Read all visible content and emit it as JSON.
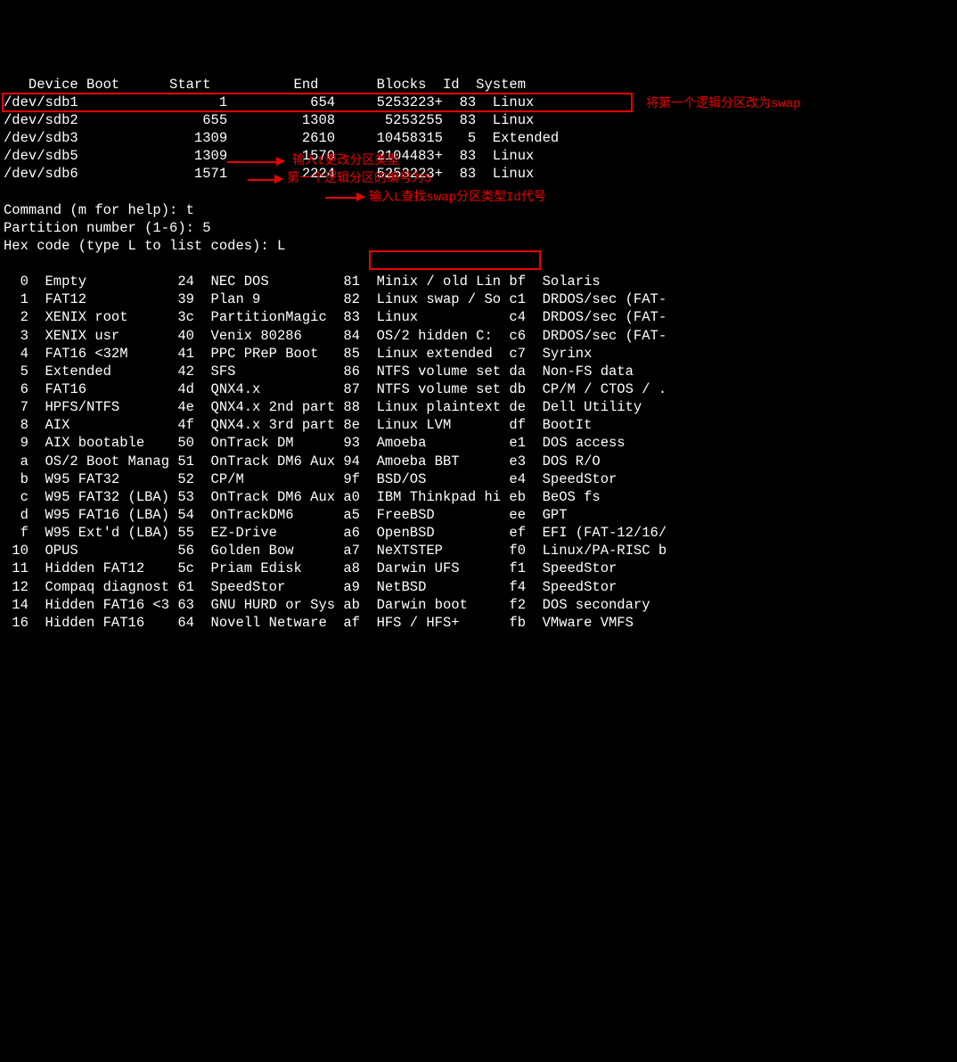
{
  "partition_table": {
    "header": {
      "device": "Device",
      "boot": "Boot",
      "start": "Start",
      "end": "End",
      "blocks": "Blocks",
      "id": "Id",
      "system": "System"
    },
    "rows": [
      {
        "device": "/dev/sdb1",
        "boot": "",
        "start": "1",
        "end": "654",
        "blocks": "5253223+",
        "id": "83",
        "system": "Linux"
      },
      {
        "device": "/dev/sdb2",
        "boot": "",
        "start": "655",
        "end": "1308",
        "blocks": "5253255",
        "id": "83",
        "system": "Linux"
      },
      {
        "device": "/dev/sdb3",
        "boot": "",
        "start": "1309",
        "end": "2610",
        "blocks": "10458315",
        "id": "5",
        "system": "Extended"
      },
      {
        "device": "/dev/sdb5",
        "boot": "",
        "start": "1309",
        "end": "1570",
        "blocks": "2104483+",
        "id": "83",
        "system": "Linux"
      },
      {
        "device": "/dev/sdb6",
        "boot": "",
        "start": "1571",
        "end": "2224",
        "blocks": "5253223+",
        "id": "83",
        "system": "Linux"
      }
    ]
  },
  "prompts": {
    "command": "Command (m for help): t",
    "partition_number": "Partition number (1-6): 5",
    "hex_code": "Hex code (type L to list codes): L"
  },
  "annotations": {
    "swap_change": "将第一个逻辑分区改为swap",
    "input_t": "输入t更改分区类型",
    "partition_5": "第一个逻辑分区的编号为5",
    "input_L": "输入L查找swap分区类型Id代号"
  },
  "type_list": {
    "col1": [
      {
        "code": "0",
        "name": "Empty"
      },
      {
        "code": "1",
        "name": "FAT12"
      },
      {
        "code": "2",
        "name": "XENIX root"
      },
      {
        "code": "3",
        "name": "XENIX usr"
      },
      {
        "code": "4",
        "name": "FAT16 <32M"
      },
      {
        "code": "5",
        "name": "Extended"
      },
      {
        "code": "6",
        "name": "FAT16"
      },
      {
        "code": "7",
        "name": "HPFS/NTFS"
      },
      {
        "code": "8",
        "name": "AIX"
      },
      {
        "code": "9",
        "name": "AIX bootable"
      },
      {
        "code": "a",
        "name": "OS/2 Boot Manag"
      },
      {
        "code": "b",
        "name": "W95 FAT32"
      },
      {
        "code": "c",
        "name": "W95 FAT32 (LBA)"
      },
      {
        "code": "d",
        "name": "W95 FAT16 (LBA)"
      },
      {
        "code": "f",
        "name": "W95 Ext'd (LBA)"
      },
      {
        "code": "10",
        "name": "OPUS"
      },
      {
        "code": "11",
        "name": "Hidden FAT12"
      },
      {
        "code": "12",
        "name": "Compaq diagnost"
      },
      {
        "code": "14",
        "name": "Hidden FAT16 <3"
      },
      {
        "code": "16",
        "name": "Hidden FAT16"
      }
    ],
    "col2": [
      {
        "code": "24",
        "name": "NEC DOS"
      },
      {
        "code": "39",
        "name": "Plan 9"
      },
      {
        "code": "3c",
        "name": "PartitionMagic"
      },
      {
        "code": "40",
        "name": "Venix 80286"
      },
      {
        "code": "41",
        "name": "PPC PReP Boot"
      },
      {
        "code": "42",
        "name": "SFS"
      },
      {
        "code": "4d",
        "name": "QNX4.x"
      },
      {
        "code": "4e",
        "name": "QNX4.x 2nd part"
      },
      {
        "code": "4f",
        "name": "QNX4.x 3rd part"
      },
      {
        "code": "50",
        "name": "OnTrack DM"
      },
      {
        "code": "51",
        "name": "OnTrack DM6 Aux"
      },
      {
        "code": "52",
        "name": "CP/M"
      },
      {
        "code": "53",
        "name": "OnTrack DM6 Aux"
      },
      {
        "code": "54",
        "name": "OnTrackDM6"
      },
      {
        "code": "55",
        "name": "EZ-Drive"
      },
      {
        "code": "56",
        "name": "Golden Bow"
      },
      {
        "code": "5c",
        "name": "Priam Edisk"
      },
      {
        "code": "61",
        "name": "SpeedStor"
      },
      {
        "code": "63",
        "name": "GNU HURD or Sys"
      },
      {
        "code": "64",
        "name": "Novell Netware"
      }
    ],
    "col3": [
      {
        "code": "81",
        "name": "Minix / old Lin"
      },
      {
        "code": "82",
        "name": "Linux swap / So"
      },
      {
        "code": "83",
        "name": "Linux"
      },
      {
        "code": "84",
        "name": "OS/2 hidden C:"
      },
      {
        "code": "85",
        "name": "Linux extended"
      },
      {
        "code": "86",
        "name": "NTFS volume set"
      },
      {
        "code": "87",
        "name": "NTFS volume set"
      },
      {
        "code": "88",
        "name": "Linux plaintext"
      },
      {
        "code": "8e",
        "name": "Linux LVM"
      },
      {
        "code": "93",
        "name": "Amoeba"
      },
      {
        "code": "94",
        "name": "Amoeba BBT"
      },
      {
        "code": "9f",
        "name": "BSD/OS"
      },
      {
        "code": "a0",
        "name": "IBM Thinkpad hi"
      },
      {
        "code": "a5",
        "name": "FreeBSD"
      },
      {
        "code": "a6",
        "name": "OpenBSD"
      },
      {
        "code": "a7",
        "name": "NeXTSTEP"
      },
      {
        "code": "a8",
        "name": "Darwin UFS"
      },
      {
        "code": "a9",
        "name": "NetBSD"
      },
      {
        "code": "ab",
        "name": "Darwin boot"
      },
      {
        "code": "af",
        "name": "HFS / HFS+"
      }
    ],
    "col4": [
      {
        "code": "bf",
        "name": "Solaris"
      },
      {
        "code": "c1",
        "name": "DRDOS/sec (FAT-"
      },
      {
        "code": "c4",
        "name": "DRDOS/sec (FAT-"
      },
      {
        "code": "c6",
        "name": "DRDOS/sec (FAT-"
      },
      {
        "code": "c7",
        "name": "Syrinx"
      },
      {
        "code": "da",
        "name": "Non-FS data"
      },
      {
        "code": "db",
        "name": "CP/M / CTOS / ."
      },
      {
        "code": "de",
        "name": "Dell Utility"
      },
      {
        "code": "df",
        "name": "BootIt"
      },
      {
        "code": "e1",
        "name": "DOS access"
      },
      {
        "code": "e3",
        "name": "DOS R/O"
      },
      {
        "code": "e4",
        "name": "SpeedStor"
      },
      {
        "code": "eb",
        "name": "BeOS fs"
      },
      {
        "code": "ee",
        "name": "GPT"
      },
      {
        "code": "ef",
        "name": "EFI (FAT-12/16/"
      },
      {
        "code": "f0",
        "name": "Linux/PA-RISC b"
      },
      {
        "code": "f1",
        "name": "SpeedStor"
      },
      {
        "code": "f4",
        "name": "SpeedStor"
      },
      {
        "code": "f2",
        "name": "DOS secondary"
      },
      {
        "code": "fb",
        "name": "VMware VMFS"
      }
    ]
  }
}
